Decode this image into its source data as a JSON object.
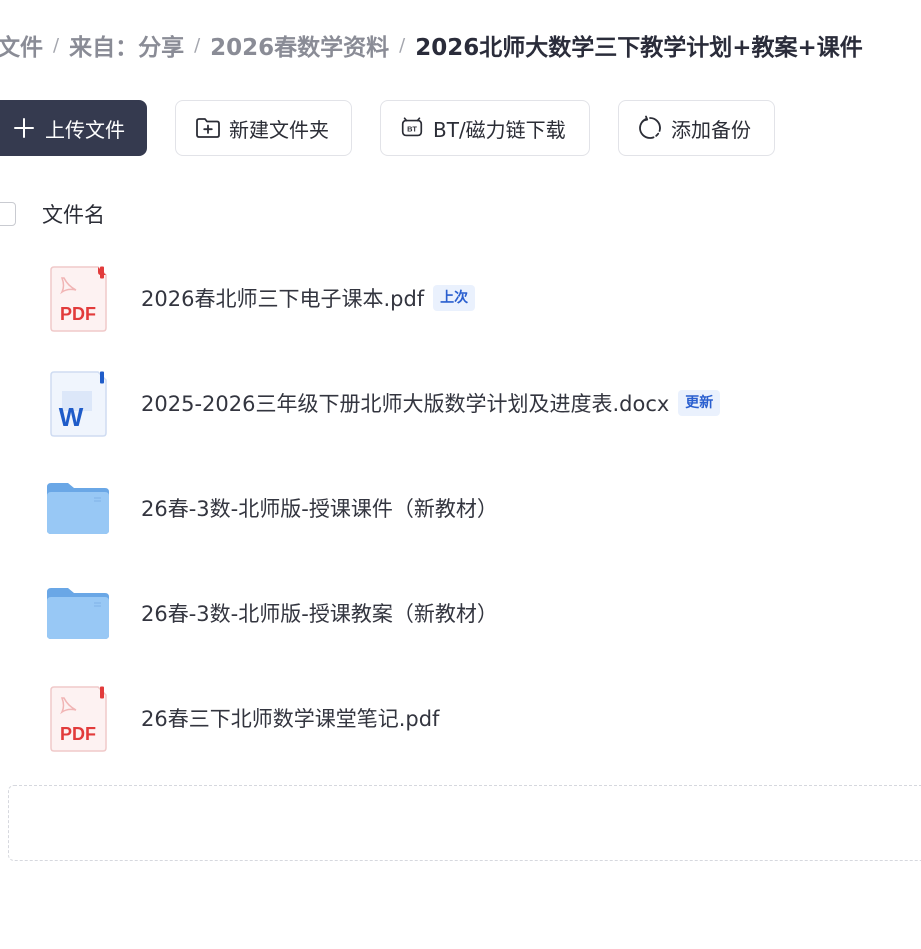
{
  "breadcrumb": {
    "items": [
      "文件",
      "来自：分享",
      "2026春数学资料"
    ],
    "separator": "/",
    "current": "2026北师大数学三下教学计划+教案+课件"
  },
  "toolbar": {
    "upload_label": "上传文件",
    "new_folder_label": "新建文件夹",
    "bt_label": "BT/磁力链下载",
    "backup_label": "添加备份"
  },
  "table": {
    "column_name": "文件名"
  },
  "files": [
    {
      "name": "2026春北师三下电子课本.pdf",
      "type": "pdf",
      "tag": "上次"
    },
    {
      "name": "2025-2026三年级下册北师大版数学计划及进度表.docx",
      "type": "word",
      "tag": "更新"
    },
    {
      "name": "26春-3数-北师版-授课课件（新教材）",
      "type": "folder",
      "tag": ""
    },
    {
      "name": "26春-3数-北师版-授课教案（新教材）",
      "type": "folder",
      "tag": ""
    },
    {
      "name": "26春三下北师数学课堂笔记.pdf",
      "type": "pdf",
      "tag": ""
    }
  ],
  "icons": {
    "pdf_label": "PDF",
    "word_label": "W",
    "bt_badge": "BT"
  },
  "colors": {
    "primary_button": "#353a4f",
    "tag_bg": "#eaf1fd",
    "tag_text": "#2a5fcf",
    "pdf_red": "#e23b3b",
    "word_blue": "#1f5cc9",
    "folder_blue": "#7fb7f0"
  }
}
